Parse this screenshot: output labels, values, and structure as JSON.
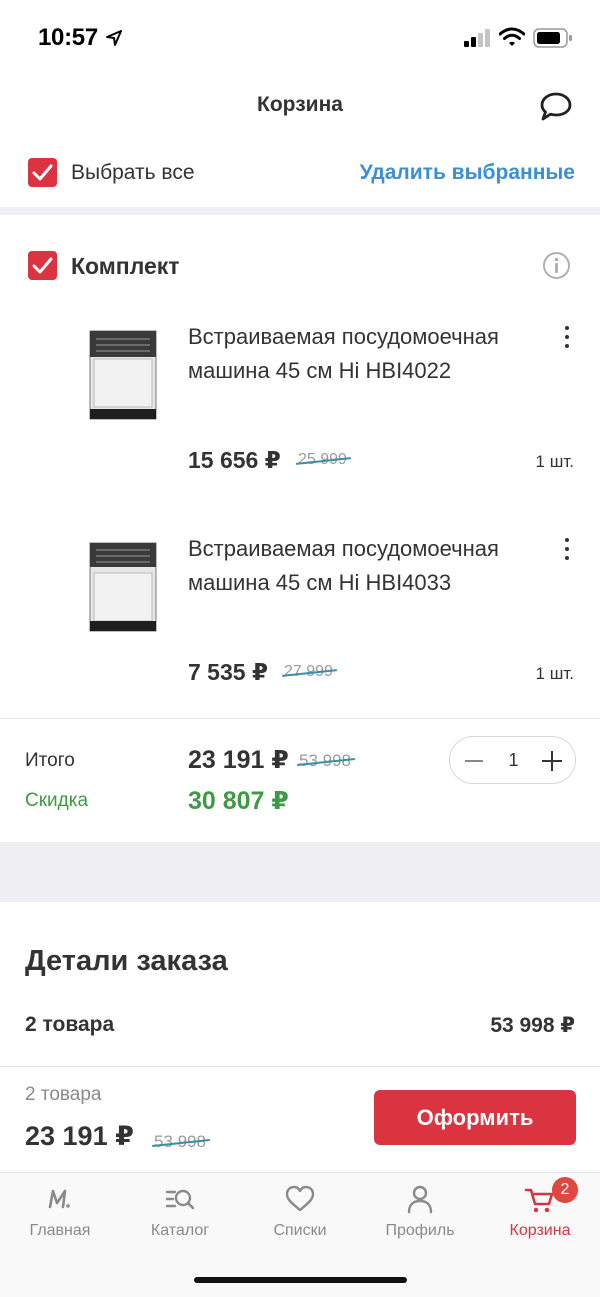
{
  "status_bar": {
    "time": "10:57"
  },
  "header": {
    "title": "Корзина"
  },
  "selection": {
    "select_all_label": "Выбрать все",
    "delete_selected_label": "Удалить выбранные"
  },
  "kit": {
    "label": "Комплект",
    "items": [
      {
        "title": "Встраиваемая посудомоечная машина 45 см Hi HBI4022",
        "price": "15 656 ₽",
        "old_price": "25 999",
        "qty": "1 шт."
      },
      {
        "title": "Встраиваемая посудомоечная машина 45 см Hi HBI4033",
        "price": "7 535 ₽",
        "old_price": "27 999",
        "qty": "1 шт."
      }
    ],
    "total_label": "Итого",
    "total_price": "23 191 ₽",
    "total_old_price": "53 998",
    "discount_label": "Скидка",
    "discount_value": "30 807 ₽",
    "quantity": "1"
  },
  "order_details": {
    "title": "Детали заказа",
    "count_label": "2 товара",
    "sum": "53 998 ₽"
  },
  "checkout": {
    "count_label": "2 товара",
    "price": "23 191 ₽",
    "old_price": "53 998",
    "button_label": "Оформить"
  },
  "tabs": [
    {
      "label": "Главная",
      "icon": "home-m-icon"
    },
    {
      "label": "Каталог",
      "icon": "catalog-search-icon"
    },
    {
      "label": "Списки",
      "icon": "heart-icon"
    },
    {
      "label": "Профиль",
      "icon": "profile-icon"
    },
    {
      "label": "Корзина",
      "icon": "cart-icon",
      "badge": "2",
      "active": true
    }
  ],
  "colors": {
    "accent_red": "#d9343f",
    "link_blue": "#3a8fd6",
    "discount_green": "#3f9a45"
  }
}
